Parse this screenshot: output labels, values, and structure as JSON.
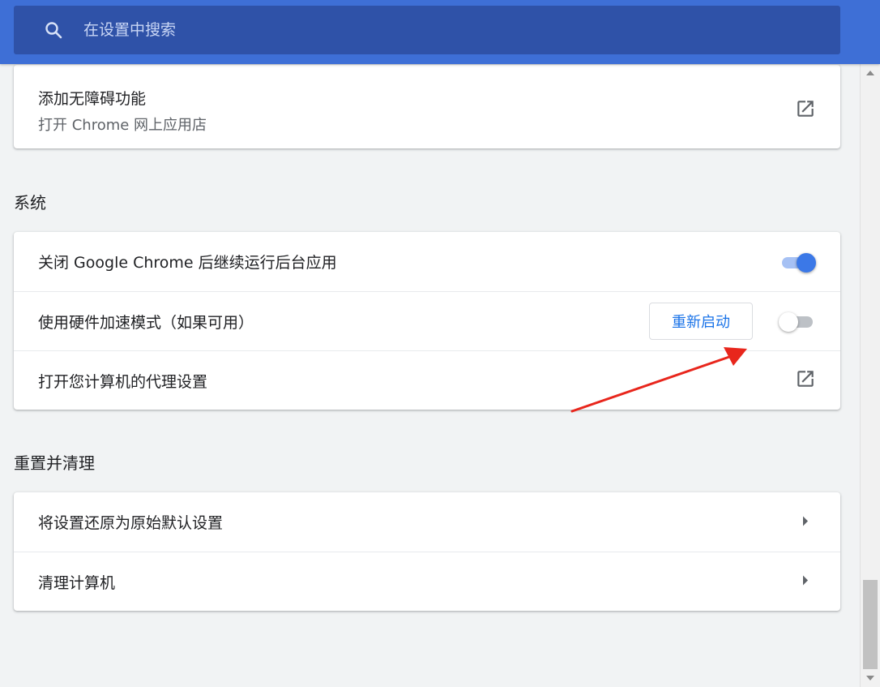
{
  "header": {
    "search_placeholder": "在设置中搜索"
  },
  "accessibility_card": {
    "title": "添加无障碍功能",
    "subtitle": "打开 Chrome 网上应用店"
  },
  "system": {
    "section_title": "系统",
    "rows": [
      {
        "label": "关闭 Google Chrome 后继续运行后台应用",
        "toggle_on": true
      },
      {
        "label": "使用硬件加速模式（如果可用）",
        "button_label": "重新启动",
        "toggle_on": false
      },
      {
        "label": "打开您计算机的代理设置"
      }
    ]
  },
  "reset": {
    "section_title": "重置并清理",
    "rows": [
      {
        "label": "将设置还原为原始默认设置"
      },
      {
        "label": "清理计算机"
      }
    ]
  },
  "colors": {
    "header_bg": "#3e6fd6",
    "search_bg": "#2f52a8",
    "accent": "#3b78e7",
    "annotation_arrow": "#e8261c"
  },
  "icons": {
    "search": "search-icon",
    "external": "open-in-new-icon",
    "chevron": "chevron-right-icon"
  }
}
